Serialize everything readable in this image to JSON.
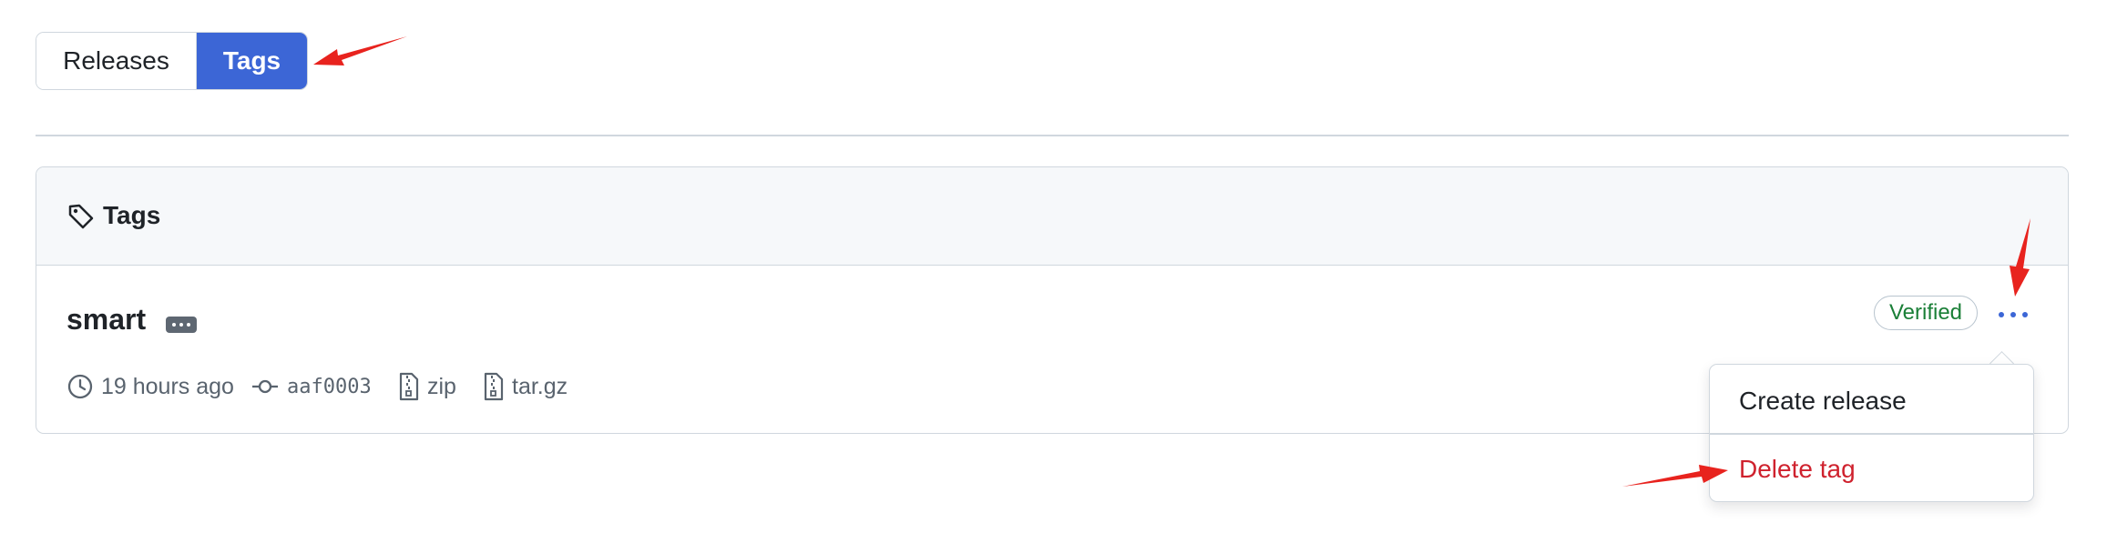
{
  "segmented": {
    "releases_label": "Releases",
    "tags_label": "Tags",
    "active": "Tags"
  },
  "box": {
    "header_title": "Tags",
    "header_icon": "tag-icon"
  },
  "tag": {
    "name": "smart",
    "time": "19 hours ago",
    "commit": "aaf0003",
    "zip_label": "zip",
    "targz_label": "tar.gz",
    "verified": "Verified"
  },
  "menu": {
    "create_release": "Create release",
    "delete_tag": "Delete tag"
  },
  "colors": {
    "accent": "#3c66d6",
    "danger": "#cf222e",
    "verified_green": "#1a7f37",
    "annotation_arrow": "#e8231e"
  }
}
